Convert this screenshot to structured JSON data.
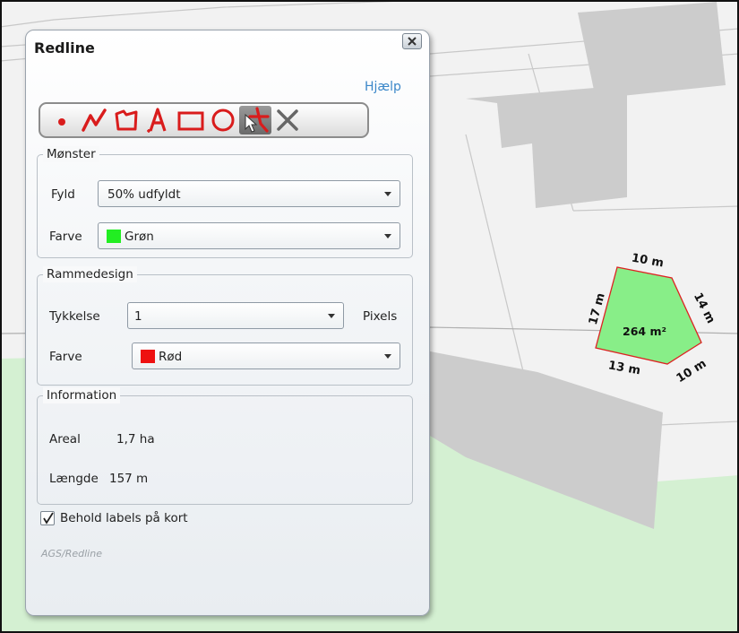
{
  "panel": {
    "title": "Redline",
    "help_link": "Hjælp",
    "footer": "AGS/Redline"
  },
  "toolbar": {
    "tools": [
      {
        "icon": "point-icon"
      },
      {
        "icon": "polyline-icon"
      },
      {
        "icon": "freehand-polygon-icon"
      },
      {
        "icon": "text-icon"
      },
      {
        "icon": "rectangle-icon"
      },
      {
        "icon": "circle-icon"
      },
      {
        "icon": "select-move-icon",
        "active": true
      },
      {
        "icon": "delete-icon"
      }
    ]
  },
  "pattern": {
    "legend": "Mønster",
    "fill_label": "Fyld",
    "fill_value": "50% udfyldt",
    "color_label": "Farve",
    "color_value": "Grøn",
    "color_hex": "#22ee22"
  },
  "border": {
    "legend": "Rammedesign",
    "thickness_label": "Tykkelse",
    "thickness_value": "1",
    "unit": "Pixels",
    "color_label": "Farve",
    "color_value": "Rød",
    "color_hex": "#ee1111"
  },
  "information": {
    "legend": "Information",
    "area_label": "Areal",
    "area_value": "1,7 ha",
    "length_label": "Længde",
    "length_value": "157 m"
  },
  "keep_labels": {
    "label": "Behold labels på kort",
    "checked": true
  },
  "map": {
    "polygon_area": "264 m²",
    "edge_labels": [
      "10 m",
      "14 m",
      "10 m",
      "13 m",
      "17 m"
    ],
    "polygon_fill": "#88ee88",
    "polygon_stroke": "#dd2222",
    "land_color": "#f2f2f2",
    "building_color": "#cccccc",
    "green_area_color": "#d4f0d2"
  }
}
